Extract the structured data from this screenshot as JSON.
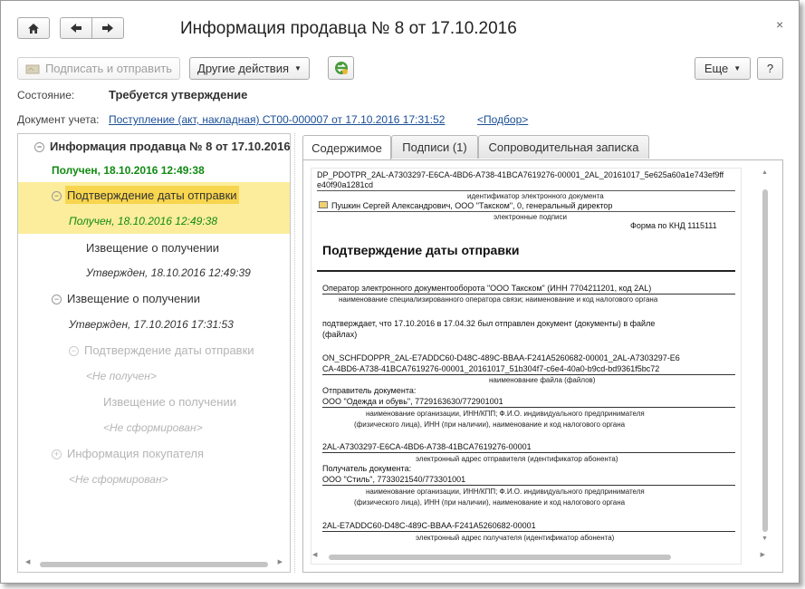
{
  "window": {
    "title": "Информация продавца № 8 от 17.10.2016",
    "close_glyph": "×"
  },
  "toolbar": {
    "sign_send_label": "Подписать и отправить",
    "other_actions_label": "Другие действия",
    "more_label": "Еще",
    "help_label": "?"
  },
  "status": {
    "label": "Состояние:",
    "value": "Требуется утверждение"
  },
  "accounting_doc": {
    "label": "Документ учета:",
    "link": "Поступление (акт, накладная) СТ00-000007 от 17.10.2016 17:31:52",
    "pick_link": "<Подбор>"
  },
  "tree": {
    "root_title": "Информация продавца № 8 от 17.10.2016",
    "root_status": "Получен, 18.10.2016 12:49:38",
    "items": [
      {
        "label": "Подтверждение даты отправки",
        "status": "Получен, 18.10.2016 12:49:38"
      },
      {
        "label": "Извещение о получении",
        "status": "Утвержден, 18.10.2016 12:49:39"
      },
      {
        "label": "Извещение о получении",
        "status": "Утвержден, 17.10.2016 17:31:53"
      },
      {
        "label": "Подтверждение даты отправки",
        "status": "<Не получен>"
      },
      {
        "label": "Извещение о получении",
        "status": "<Не сформирован>"
      },
      {
        "label": "Информация покупателя",
        "status": "<Не сформирован>"
      }
    ]
  },
  "tabs": [
    {
      "label": "Содержимое",
      "active": true
    },
    {
      "label": "Подписи (1)",
      "active": false
    },
    {
      "label": "Сопроводительная записка",
      "active": false
    }
  ],
  "document": {
    "file_id_line1": "DP_PDOTPR_2AL-A7303297-E6CA-4BD6-A738-41BCA7619276-00001_2AL_20161017_5e625a60a1e743ef9ff",
    "file_id_line2": "e40f90a1281cd",
    "cap_edoc_id": "идентификатор электронного документа",
    "signer": "Пушкин Сергей Александрович, ООО \"Такском\", 0, генеральный директор",
    "cap_signatures": "электронные подписи",
    "form_code": "Форма по КНД 1115111",
    "heading": "Подтверждение даты отправки",
    "operator": "Оператор электронного документооборота \"ООО Такском\" (ИНН 7704211201, код 2AL)",
    "cap_operator": "наименование специализированного оператора связи; наименование и код налогового органа",
    "confirm_line1": "подтверждает, что 17.10.2016 в 17.04.32 был отправлен документ  (документы) в файле",
    "confirm_line2": "(файлах)",
    "file_name_line1": "ON_SCHFDOPPR_2AL-E7ADDC60-D48C-489C-BBAA-F241A5260682-00001_2AL-A7303297-E6",
    "file_name_line2": "CA-4BD6-A738-41BCA7619276-00001_20161017_51b304f7-c6e4-40a0-b9cd-bd9361f5bc72",
    "cap_file_name": "наименование файла (файлов)",
    "sender_label": "Отправитель документа:",
    "sender": "ООО \"Одежда и обувь\", 7729163630/772901001",
    "cap_org_line1": "наименование организации, ИНН/КПП; Ф.И.О. индивидуального предпринимателя",
    "cap_org_line2": "(физического лица), ИНН (при наличии), наименование и код налогового органа",
    "sender_addr": "2AL-A7303297-E6CA-4BD6-A738-41BCA7619276-00001",
    "cap_sender_addr": "электронный адрес отправителя (идентификатор абонента)",
    "receiver_label": "Получатель документа:",
    "receiver": "ООО \"Стиль\", 7733021540/773301001",
    "receiver_addr": "2AL-E7ADDC60-D48C-489C-BBAA-F241A5260682-00001",
    "cap_receiver_addr": "электронный адрес получателя (идентификатор абонента)"
  }
}
